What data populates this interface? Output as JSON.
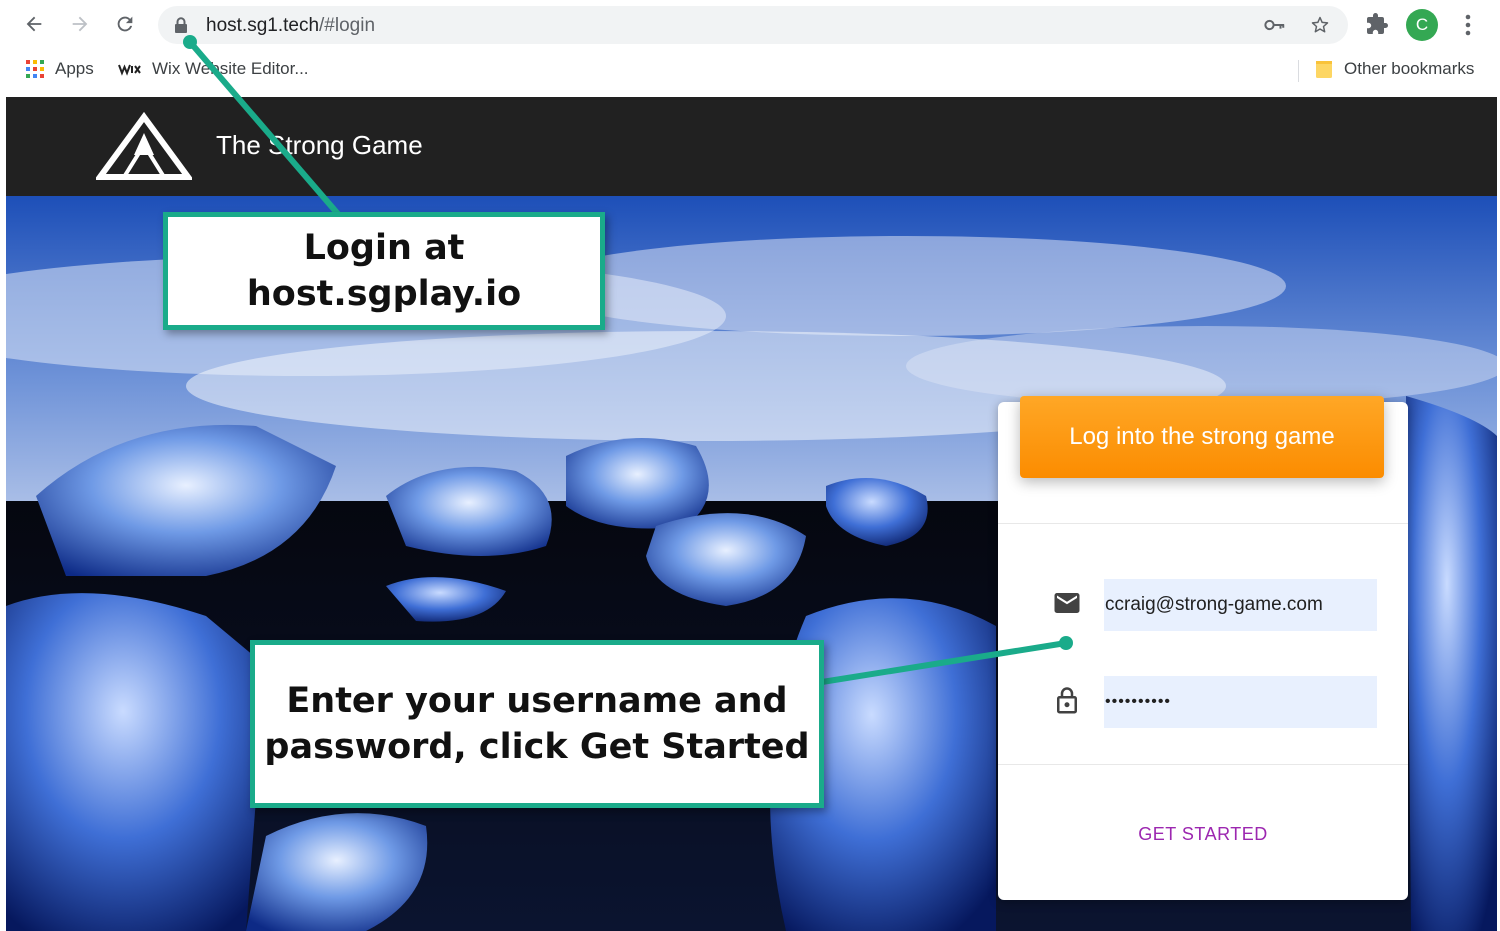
{
  "browser": {
    "url_host": "host.sg1.tech",
    "url_path": "/#login",
    "profile_initial": "C",
    "bookmarks": [
      {
        "label": "Apps",
        "icon": "apps-grid-icon"
      },
      {
        "label": "Wix Website Editor...",
        "icon": "wix-favicon-icon"
      }
    ],
    "other_bookmarks": "Other bookmarks"
  },
  "app": {
    "title": "The Strong Game"
  },
  "login": {
    "header": "Log into the strong game",
    "email_value": "ccraig@strong-game.com",
    "password_value": "••••••••••",
    "submit_label": "GET STARTED"
  },
  "annotations": {
    "callout_1_line1": "Login at",
    "callout_1_line2": "host.sgplay.io",
    "callout_2_line1": "Enter your username and",
    "callout_2_line2": "password, click Get Started"
  },
  "colors": {
    "accent_orange": "#fb8c00",
    "button_purple": "#9c27b0",
    "callout_border": "#1aab8a",
    "header_bg": "#212121",
    "input_bg": "#e8f0fe"
  }
}
